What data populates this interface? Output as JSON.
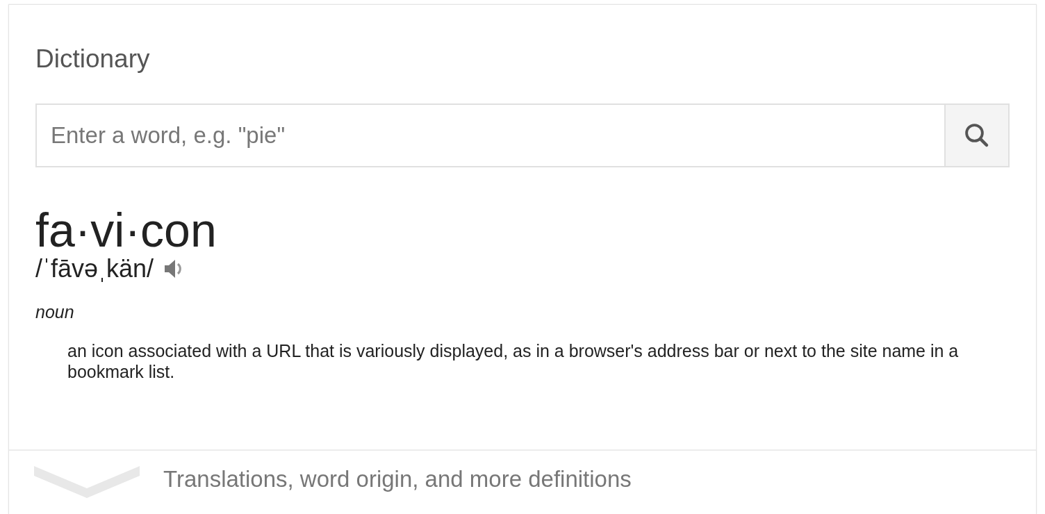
{
  "title": "Dictionary",
  "search": {
    "placeholder": "Enter a word, e.g. \"pie\""
  },
  "entry": {
    "word": "fa·vi·con",
    "pronunciation": "/ˈfāvəˌkän/",
    "part_of_speech": "noun",
    "definitions": [
      "an icon associated with a URL that is variously displayed, as in a browser's address bar or next to the site name in a bookmark list."
    ]
  },
  "more": {
    "label": "Translations, word origin, and more definitions",
    "expanded": false
  }
}
